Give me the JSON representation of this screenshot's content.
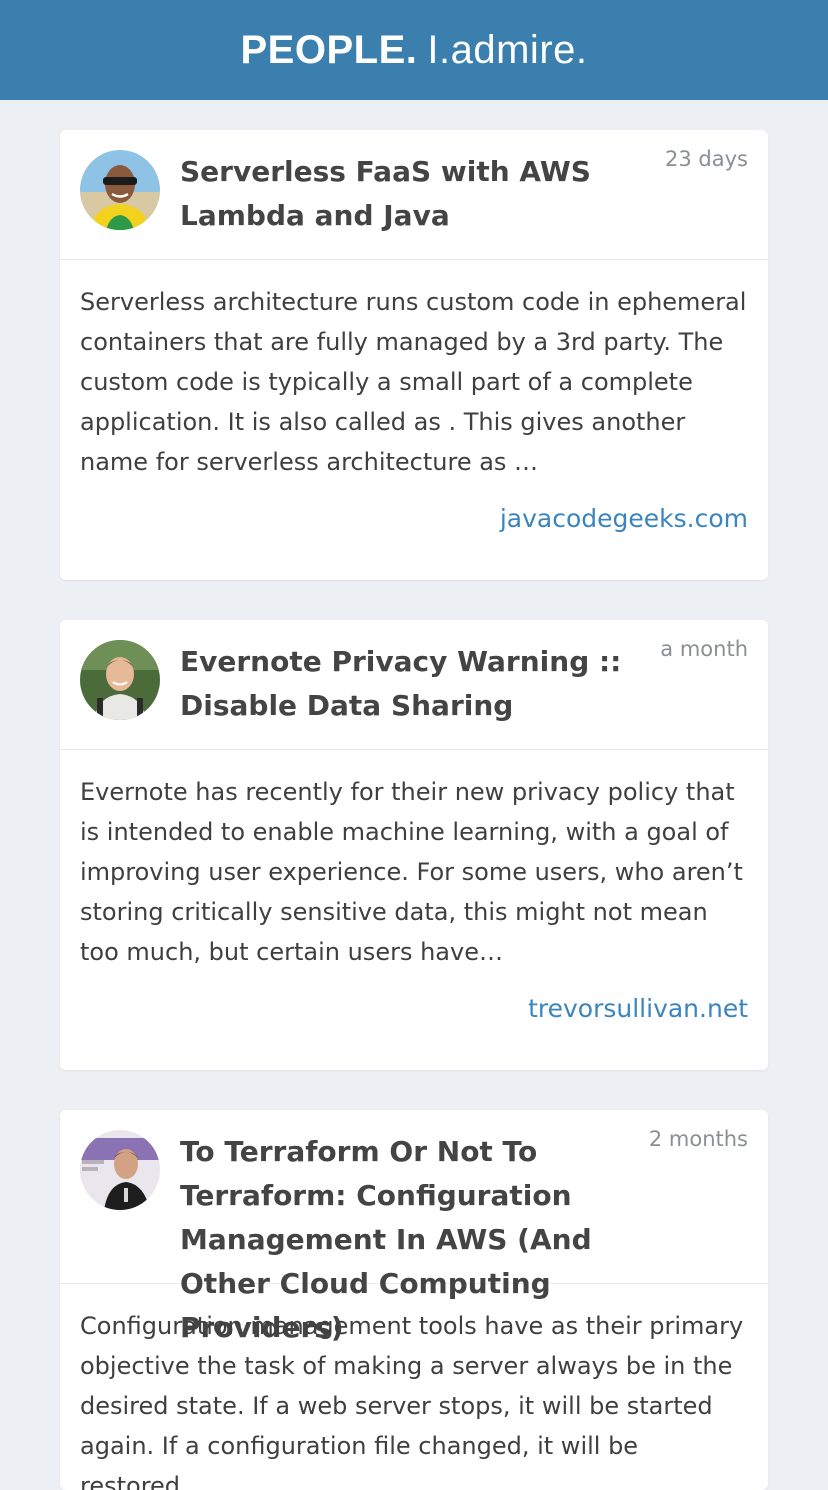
{
  "header": {
    "brand_strong": "PEOPLE.",
    "brand_light": "I.admire."
  },
  "colors": {
    "header_bg": "#3a7fad",
    "page_bg": "#eceff3",
    "link": "#3a85bf"
  },
  "articles": [
    {
      "title": "Serverless FaaS with AWS Lambda and Java",
      "time": "23 days",
      "excerpt": "Serverless architecture runs custom code in ephemeral containers that are fully managed by a 3rd party. The custom code is typically a small part of a complete application. It is also called as  . This gives another name for serverless architecture as  …",
      "source": "javacodegeeks.com",
      "avatar": "author-photo-sunglasses"
    },
    {
      "title": "Evernote Privacy Warning :: Disable Data Sharing",
      "time": "a month",
      "excerpt": "Evernote has recently for their new privacy policy that is intended to enable machine learning, with a goal of improving user experience. For some users, who aren’t storing critically sensitive data, this might not mean too much, but certain users have…",
      "source": "trevorsullivan.net",
      "avatar": "author-photo-outdoor"
    },
    {
      "title": "To Terraform Or Not To Terraform: Configuration Management In AWS (And Other Cloud Computing Providers)",
      "time": "2 months",
      "excerpt": "Configuration management tools have as their primary objective the task of making a server always be in the desired state. If a web server stops, it will be started again. If a configuration file changed, it will be restored.",
      "source": "",
      "avatar": "author-photo-speaker"
    }
  ]
}
